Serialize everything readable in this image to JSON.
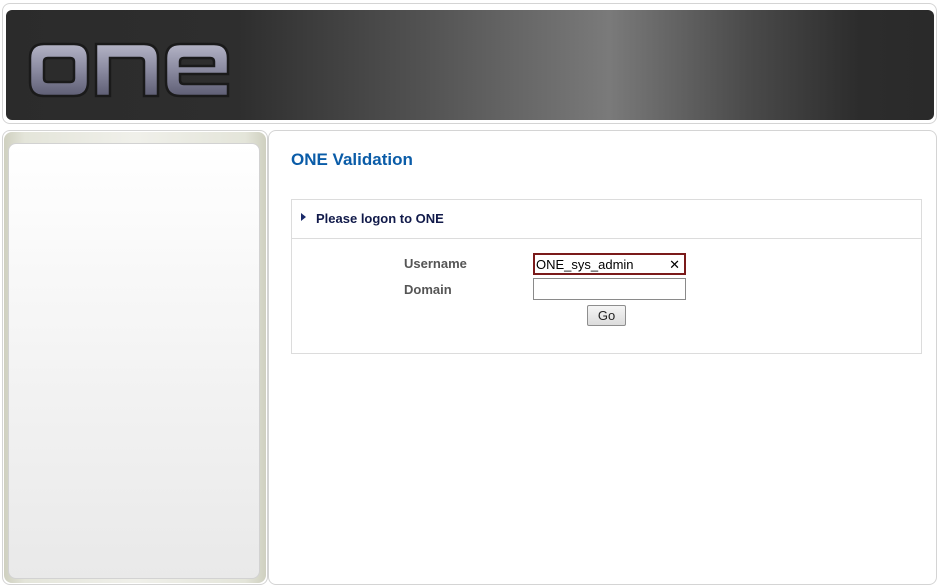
{
  "header": {
    "logo_text": "one",
    "colors": {
      "banner_dark": "#2a2a2a",
      "banner_light": "#7a7a7a",
      "logo_fill": "#8a8a9e"
    }
  },
  "main": {
    "title": "ONE Validation",
    "title_color": "#0a5ca8",
    "login_box": {
      "header_text": "Please logon to ONE",
      "header_icon": "triangle-right-icon",
      "username": {
        "label": "Username",
        "value": "ONE_sys_admin",
        "clear_icon": "close-icon"
      },
      "domain": {
        "label": "Domain",
        "value": ""
      },
      "go_label": "Go"
    }
  }
}
